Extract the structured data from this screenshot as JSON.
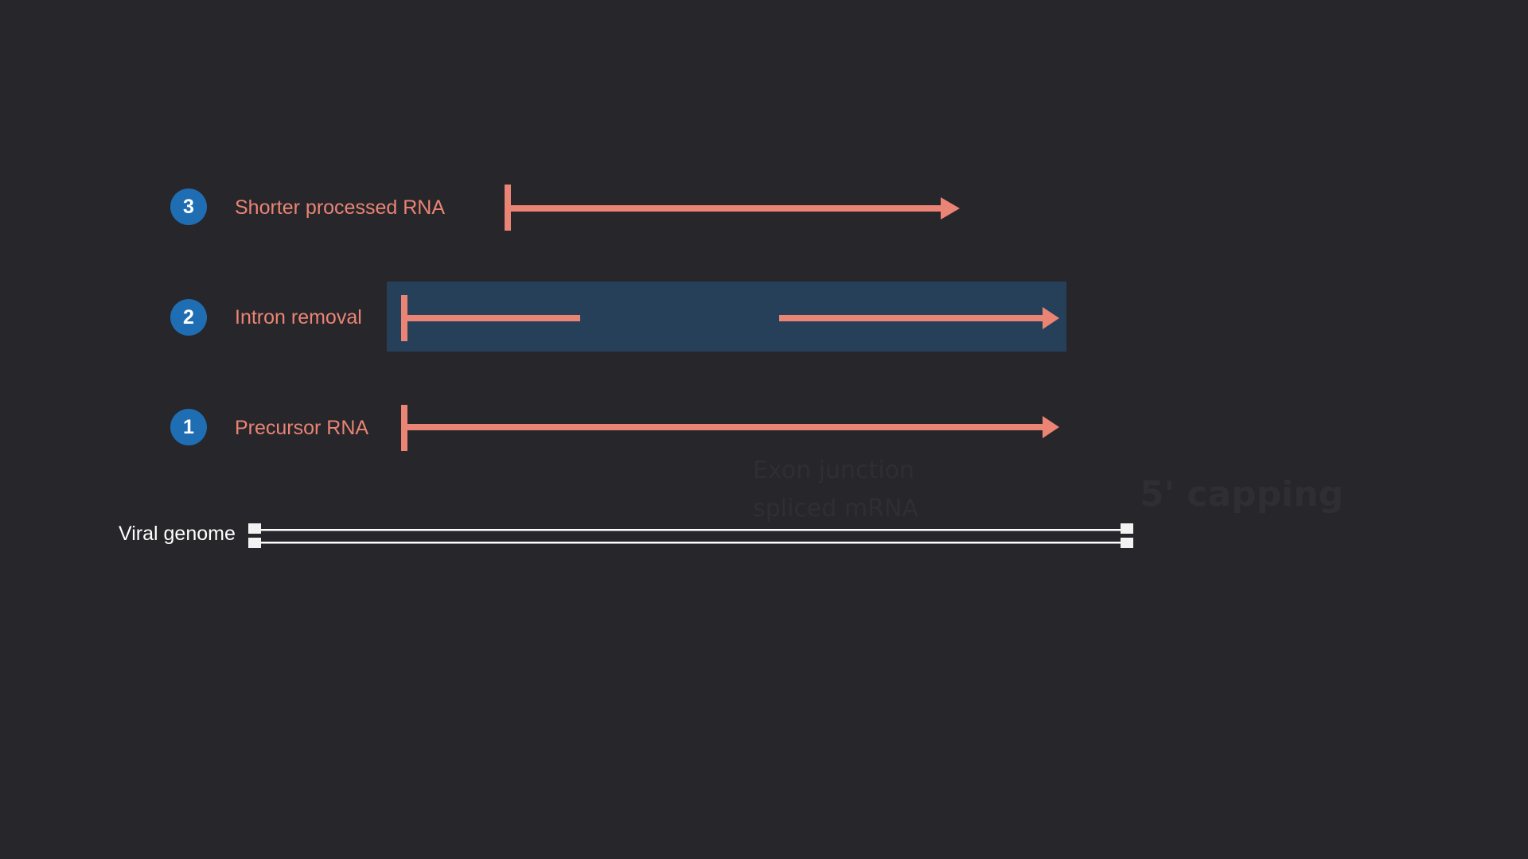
{
  "steps": [
    {
      "number": "3",
      "label": "Shorter processed RNA"
    },
    {
      "number": "2",
      "label": "Intron removal"
    },
    {
      "number": "1",
      "label": "Precursor RNA"
    }
  ],
  "genome": {
    "label": "Viral genome"
  },
  "ghost_labels": {
    "capping": "5' capping",
    "faint_line_1": "Exon junction",
    "faint_line_2": "spliced mRNA"
  },
  "colors": {
    "background": "#27262b",
    "rna_arrow": "#ea8474",
    "badge": "#1f6eb3",
    "highlight": "#27405a",
    "genome": "#ffffff"
  }
}
